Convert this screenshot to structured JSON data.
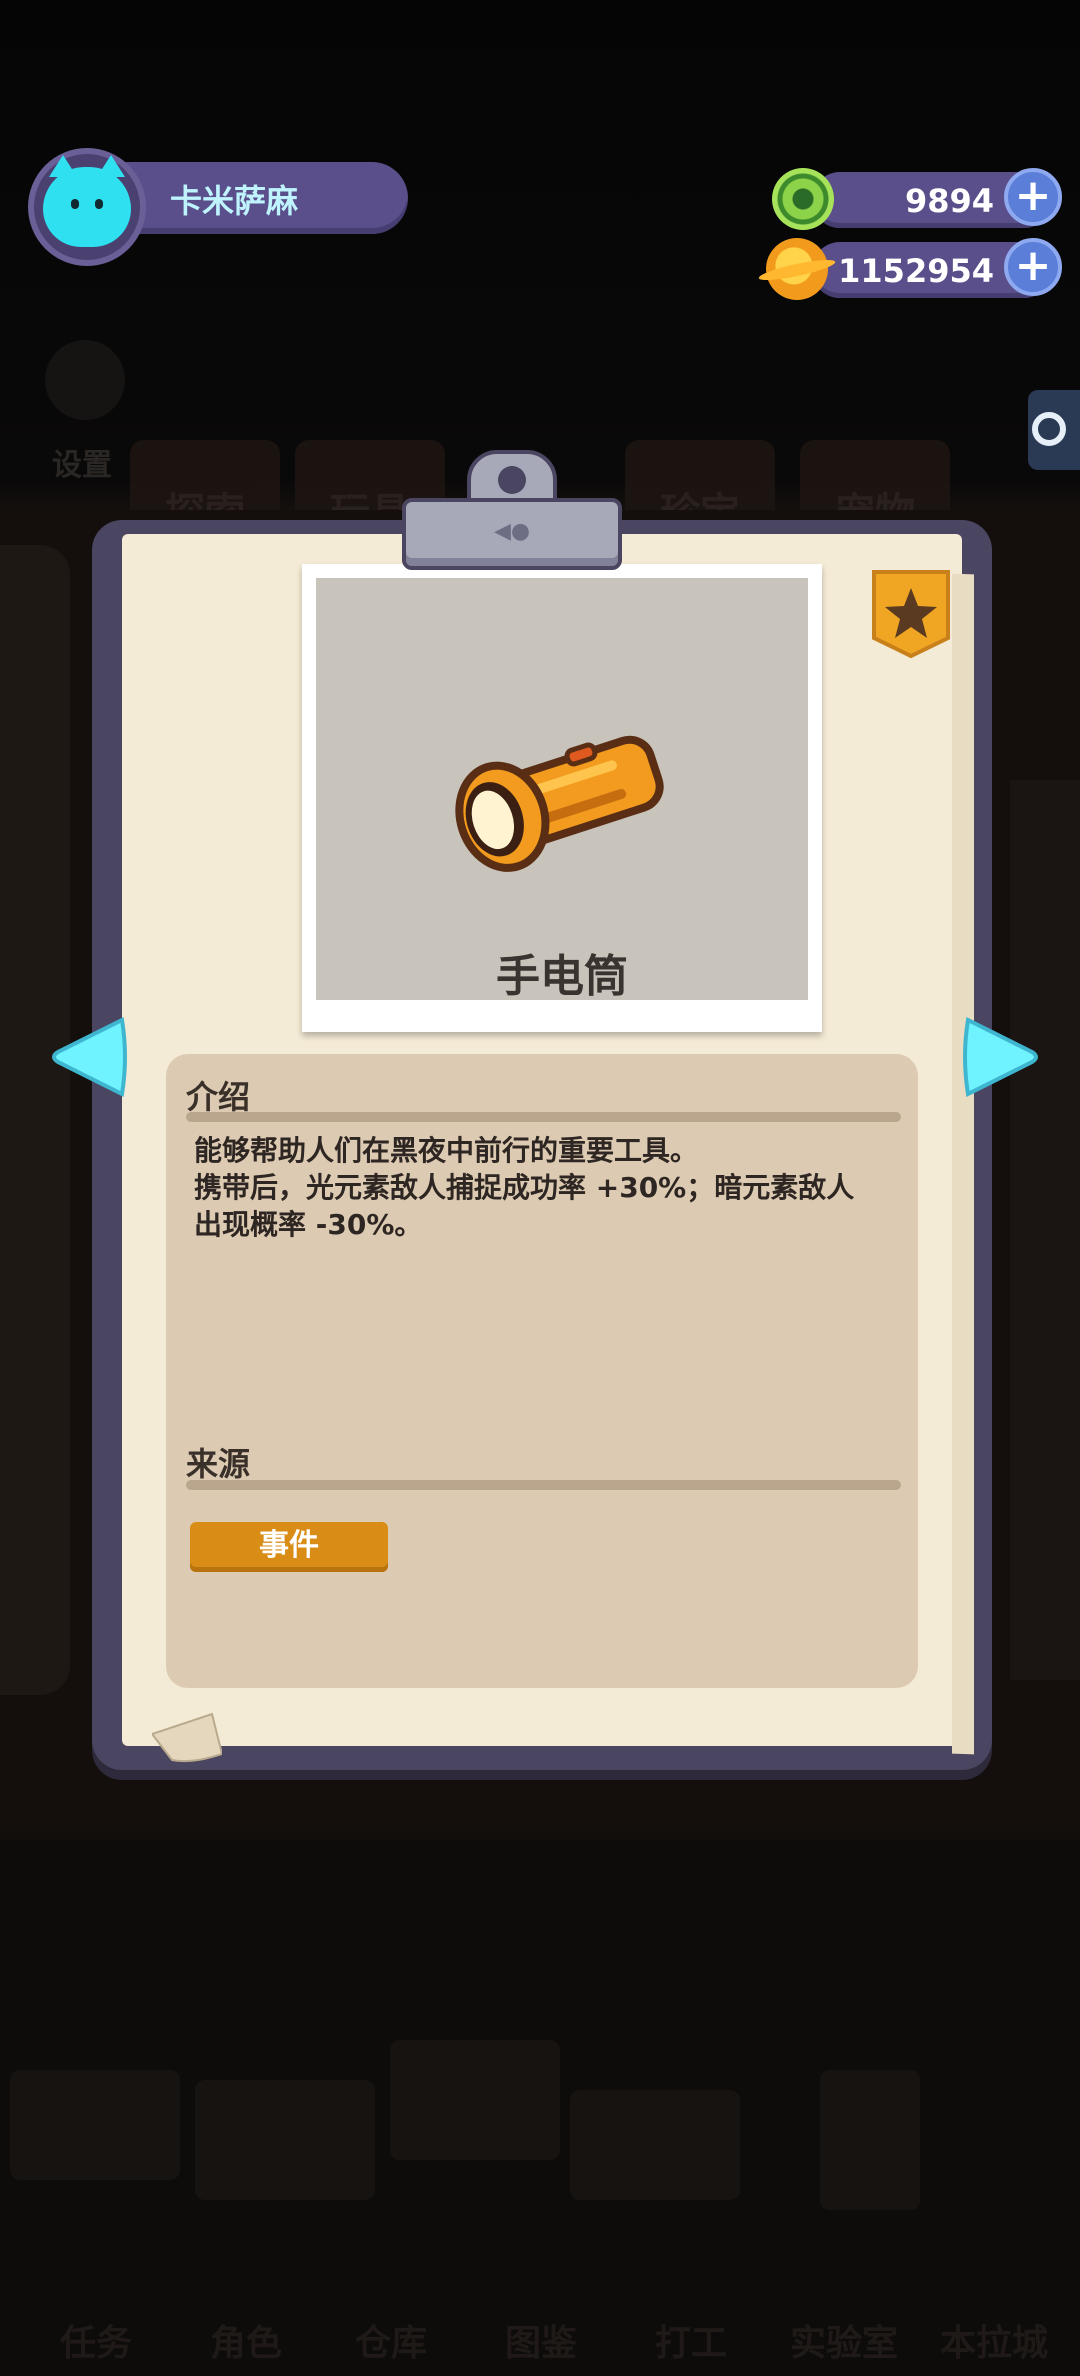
{
  "profile": {
    "name": "卡米萨麻"
  },
  "currencies": [
    {
      "name": "green-token",
      "value": "9894",
      "color": "#7cc43a"
    },
    {
      "name": "gold-coin",
      "value": "1152954",
      "color": "#f5a623"
    }
  ],
  "background": {
    "settings_label": "设置",
    "tabs": [
      "探索",
      "玩具",
      "",
      "珍宝",
      "宠物"
    ],
    "nav": [
      "任务",
      "角色",
      "仓库",
      "图鉴",
      "打工",
      "实验室",
      "本拉城"
    ]
  },
  "item": {
    "name": "手电筒",
    "icon": "flashlight-icon",
    "favorite_icon": "star-icon"
  },
  "intro": {
    "title": "介绍",
    "text": "能够帮助人们在黑夜中前行的重要工具。\n携带后，光元素敌人捕捉成功率 +30%；暗元素敌人\n出现概率 -30%。"
  },
  "source": {
    "title": "来源",
    "tag": "事件"
  },
  "colors": {
    "accent_cyan": "#6ff3ff",
    "panel_purple": "#5a4f8a",
    "tag_orange": "#d98d17"
  }
}
